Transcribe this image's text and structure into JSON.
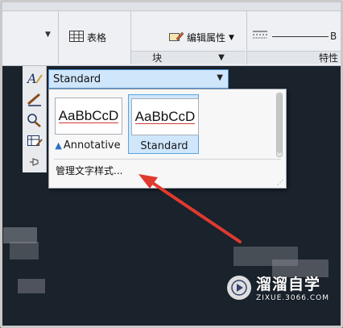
{
  "ribbon": {
    "table_label": "表格",
    "edit_attributes_label": "编辑属性",
    "block_group_label": "块",
    "properties_group_label": "特性",
    "line_label": "B"
  },
  "style_selector": {
    "current_value": "Standard"
  },
  "gallery": {
    "items": [
      {
        "preview_text": "AaBbCcD",
        "name": "Annotative",
        "annotative": true,
        "selected": false
      },
      {
        "preview_text": "AaBbCcD",
        "name": "Standard",
        "annotative": false,
        "selected": true
      }
    ],
    "manage_label": "管理文字样式..."
  },
  "tools": [
    {
      "icon": "text-style-icon"
    },
    {
      "icon": "dimension-style-icon"
    },
    {
      "icon": "multileader-style-icon"
    },
    {
      "icon": "table-style-icon"
    },
    {
      "icon": "pin-icon"
    }
  ],
  "watermark": {
    "title": "溜溜自学",
    "url": "ZIXUE.3066.COM"
  },
  "colors": {
    "canvas": "#1a222c",
    "selection": "#cfe6fb",
    "accent_border": "#4f8fd0",
    "arrow": "#e03a2f"
  }
}
